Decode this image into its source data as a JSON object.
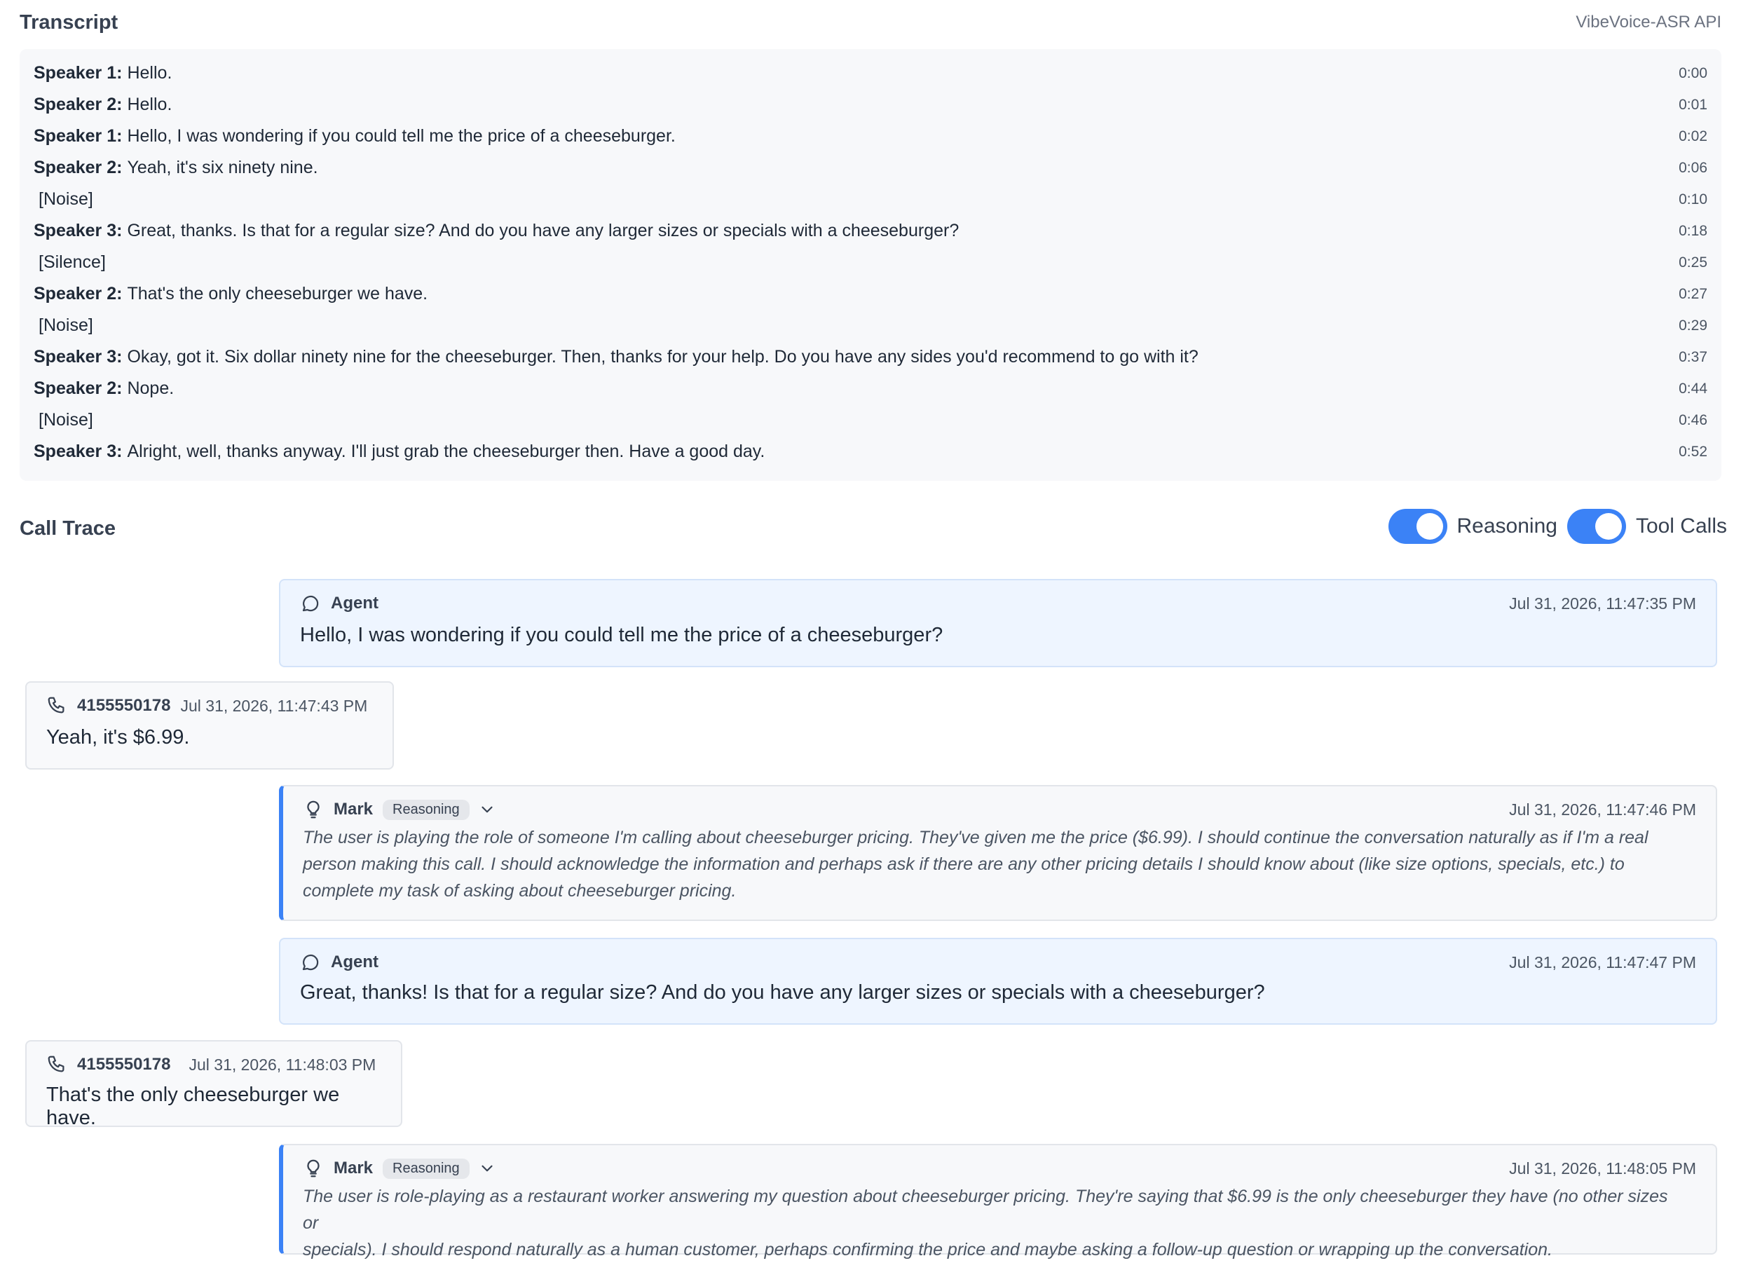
{
  "transcript": {
    "title": "Transcript",
    "api_label": "VibeVoice-ASR API",
    "rows": [
      {
        "speaker": "Speaker 1:",
        "text": "Hello.",
        "time": "0:00"
      },
      {
        "speaker": "Speaker 2:",
        "text": "Hello.",
        "time": "0:01"
      },
      {
        "speaker": "Speaker 1:",
        "text": "Hello, I was wondering if you could tell me the price of a cheeseburger.",
        "time": "0:02"
      },
      {
        "speaker": "Speaker 2:",
        "text": "Yeah, it's six ninety nine.",
        "time": "0:06"
      },
      {
        "speaker": "",
        "text": "[Noise]",
        "time": "0:10"
      },
      {
        "speaker": "Speaker 3:",
        "text": "Great, thanks. Is that for a regular size? And do you have any larger sizes or specials with a cheeseburger?",
        "time": "0:18"
      },
      {
        "speaker": "",
        "text": "[Silence]",
        "time": "0:25"
      },
      {
        "speaker": "Speaker 2:",
        "text": "That's the only cheeseburger we have.",
        "time": "0:27"
      },
      {
        "speaker": "",
        "text": "[Noise]",
        "time": "0:29"
      },
      {
        "speaker": "Speaker 3:",
        "text": "Okay, got it. Six dollar ninety nine for the cheeseburger. Then, thanks for your help. Do you have any sides you'd recommend to go with it?",
        "time": "0:37"
      },
      {
        "speaker": "Speaker 2:",
        "text": "Nope.",
        "time": "0:44"
      },
      {
        "speaker": "",
        "text": "[Noise]",
        "time": "0:46"
      },
      {
        "speaker": "Speaker 3:",
        "text": "Alright, well, thanks anyway. I'll just grab the cheeseburger then. Have a good day.",
        "time": "0:52"
      }
    ]
  },
  "call_trace": {
    "title": "Call Trace",
    "toggles": [
      {
        "label": "Reasoning",
        "on": true
      },
      {
        "label": "Tool Calls",
        "on": true
      }
    ],
    "entries": [
      {
        "type": "agent",
        "name": "Agent",
        "icon": "chat-bubble-icon",
        "time": "Jul 31, 2026, 11:47:35 PM",
        "text": "Hello, I was wondering if you could tell me the price of a cheeseburger?"
      },
      {
        "type": "caller",
        "name": "4155550178",
        "icon": "phone-icon",
        "time": "Jul 31, 2026, 11:47:43 PM",
        "text": "Yeah, it's $6.99."
      },
      {
        "type": "reasoning",
        "name": "Mark",
        "badge": "Reasoning",
        "icon": "lightbulb-icon",
        "time": "Jul 31, 2026, 11:47:46 PM",
        "lines": [
          "The user is playing the role of someone I'm calling about cheeseburger pricing. They've given me the price ($6.99). I should continue the conversation naturally as if I'm a real",
          "person making this call. I should acknowledge the information and perhaps ask if there are any other pricing details I should know about (like size options, specials, etc.) to",
          "complete my task of asking about cheeseburger pricing."
        ]
      },
      {
        "type": "agent",
        "name": "Agent",
        "icon": "chat-bubble-icon",
        "time": "Jul 31, 2026, 11:47:47 PM",
        "text": "Great, thanks! Is that for a regular size? And do you have any larger sizes or specials with a cheeseburger?"
      },
      {
        "type": "caller",
        "name": "4155550178",
        "icon": "phone-icon",
        "time": "Jul 31, 2026, 11:48:03 PM",
        "text": "That's the only cheeseburger we have."
      },
      {
        "type": "reasoning",
        "name": "Mark",
        "badge": "Reasoning",
        "icon": "lightbulb-icon",
        "time": "Jul 31, 2026, 11:48:05 PM",
        "lines": [
          "The user is role-playing as a restaurant worker answering my question about cheeseburger pricing. They're saying that $6.99 is the only cheeseburger they have (no other sizes or",
          "specials). I should respond naturally as a human customer, perhaps confirming the price and maybe asking a follow-up question or wrapping up the conversation."
        ]
      }
    ]
  }
}
